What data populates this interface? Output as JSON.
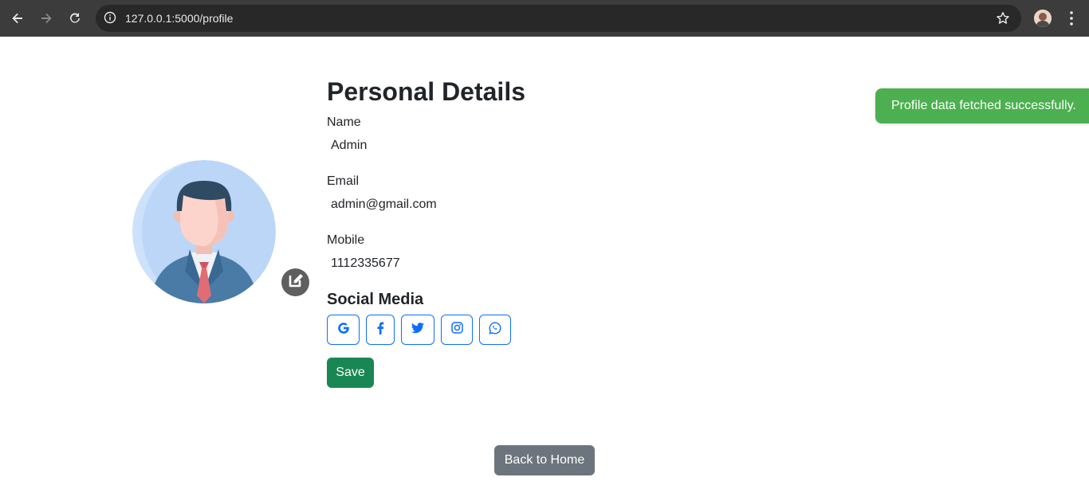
{
  "browser": {
    "url": "127.0.0.1:5000/profile"
  },
  "profile": {
    "title": "Personal Details",
    "fields": [
      {
        "label": "Name",
        "value": "Admin"
      },
      {
        "label": "Email",
        "value": "admin@gmail.com"
      },
      {
        "label": "Mobile",
        "value": "1112335677"
      }
    ],
    "social_title": "Social Media",
    "social_links": [
      "google-icon",
      "facebook-icon",
      "twitter-icon",
      "instagram-icon",
      "whatsapp-icon"
    ],
    "save_label": "Save"
  },
  "toast": {
    "message": "Profile data fetched successfully."
  },
  "footer": {
    "back_label": "Back to Home"
  },
  "colors": {
    "primary": "#0d6efd",
    "success": "#198754",
    "toast": "#4caf50",
    "secondary": "#6c757d"
  }
}
